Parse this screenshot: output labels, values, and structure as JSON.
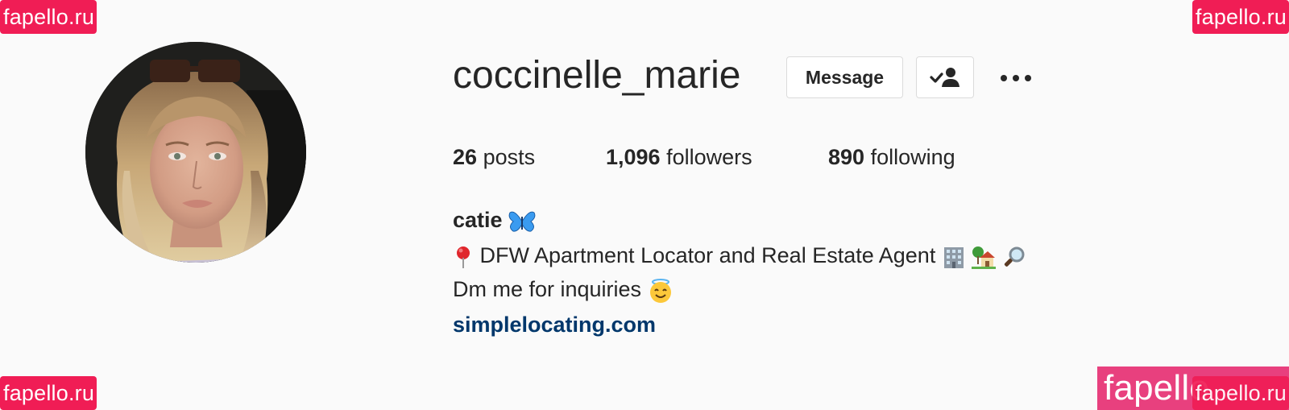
{
  "watermarks": {
    "text": "fapello.ru",
    "partial_text": "fapello"
  },
  "profile": {
    "username": "coccinelle_marie",
    "avatar_icon": "profile-photo"
  },
  "actions": {
    "message_label": "Message",
    "follow_icon": "following-check-person-icon",
    "more_icon": "more-options-icon"
  },
  "stats": {
    "posts_count": "26",
    "posts_label": "posts",
    "followers_count": "1,096",
    "followers_label": "followers",
    "following_count": "890",
    "following_label": "following"
  },
  "bio": {
    "name": "catie",
    "line1": "DFW Apartment Locator and Real Estate Agent",
    "line2": "Dm me for inquiries",
    "link": "simplelocating.com"
  },
  "colors": {
    "background": "#fafafa",
    "text": "#262626",
    "link": "#00376b",
    "border": "#dbdbdb",
    "watermark": "#f01d55"
  }
}
